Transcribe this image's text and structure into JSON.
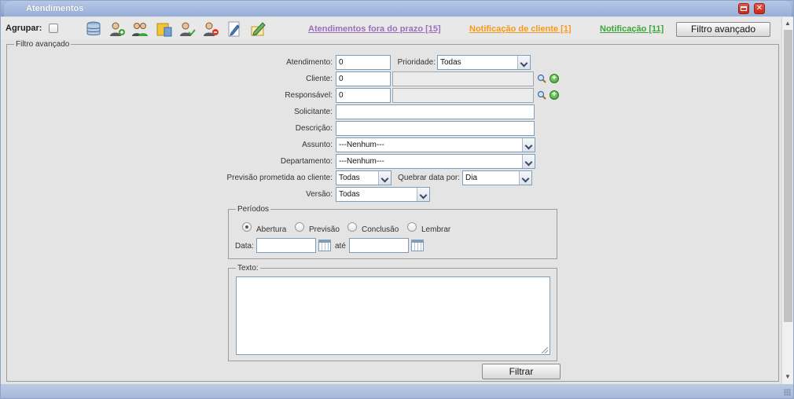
{
  "window": {
    "title": "Atendimentos",
    "maximize_icon": "maximize-icon",
    "close_icon": "close-icon",
    "close_glyph": "✕"
  },
  "toolbar": {
    "group_label": "Agrupar:",
    "group_checked": false,
    "icons": [
      "database-icon",
      "add-user-icon",
      "users-icon",
      "folder-note-icon",
      "user-check-icon",
      "user-remove-icon",
      "edit-document-icon",
      "pencil-note-icon"
    ],
    "links": {
      "overdue": "Atendimentos fora do prazo [15]",
      "client_notification": "Notificação de cliente [1]",
      "notification": "Notificação [11]"
    },
    "advanced_filter_button": "Filtro avançado",
    "colors": {
      "overdue": "#9a6fb6",
      "client_notification": "#f39a1c",
      "notification": "#3ea33a"
    }
  },
  "filter": {
    "legend": "Filtro avançado",
    "atendimento": {
      "label": "Atendimento:",
      "value": "0"
    },
    "prioridade": {
      "label": "Prioridade:",
      "value": "Todas"
    },
    "cliente": {
      "label": "Cliente:",
      "value": "0",
      "name_value": ""
    },
    "responsavel": {
      "label": "Responsável:",
      "value": "0",
      "name_value": ""
    },
    "solicitante": {
      "label": "Solicitante:",
      "value": ""
    },
    "descricao": {
      "label": "Descrição:",
      "value": ""
    },
    "assunto": {
      "label": "Assunto:",
      "value": "---Nenhum---"
    },
    "departamento": {
      "label": "Departamento:",
      "value": "---Nenhum---"
    },
    "previsao": {
      "label": "Previsão prometida ao cliente:",
      "value": "Todas"
    },
    "quebrar": {
      "label": "Quebrar data por:",
      "value": "Dia"
    },
    "versao": {
      "label": "Versão:",
      "value": "Todas"
    },
    "periods": {
      "legend": "Períodos",
      "options": [
        "Abertura",
        "Previsão",
        "Conclusão",
        "Lembrar"
      ],
      "selected": "Abertura",
      "date_label": "Data:",
      "until_label": "até",
      "from_value": "",
      "to_value": ""
    },
    "texto": {
      "legend": "Texto:",
      "value": ""
    },
    "submit": "Filtrar"
  }
}
